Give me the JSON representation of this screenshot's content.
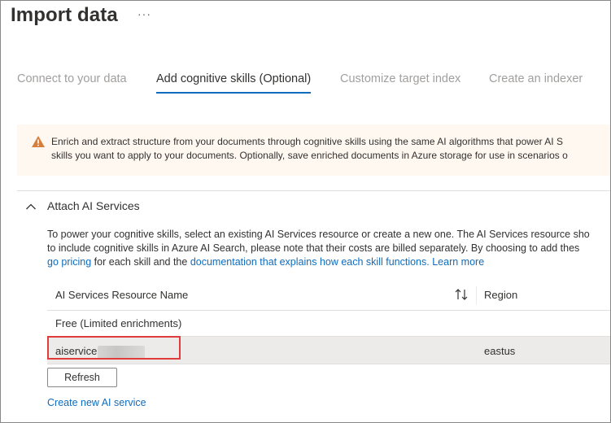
{
  "page": {
    "title": "Import data",
    "more_glyph": "···"
  },
  "tabs": [
    {
      "label": "Connect to your data",
      "active": false
    },
    {
      "label": "Add cognitive skills (Optional)",
      "active": true
    },
    {
      "label": "Customize target index",
      "active": false
    },
    {
      "label": "Create an indexer",
      "active": false
    }
  ],
  "warning": {
    "line1": "Enrich and extract structure from your documents through cognitive skills using the same AI algorithms that power AI S",
    "line2": "skills you want to apply to your documents. Optionally, save enriched documents in Azure storage for use in scenarios o",
    "icon": "warning-icon",
    "color": "#d67f3c"
  },
  "section": {
    "title": "Attach AI Services",
    "expanded": true,
    "description": {
      "line1": "To power your cognitive skills, select an existing AI Services resource or create a new one. The AI Services resource sho",
      "line2": "to include cognitive skills in Azure AI Search, please note that their costs are billed separately. By choosing to add thes",
      "line3_link1": "go pricing",
      "line3_text1": " for each skill and the ",
      "line3_link2": "documentation that explains how each skill functions.",
      "line3_text2": " ",
      "line3_link3": "Learn more"
    }
  },
  "grid": {
    "columns": {
      "name": "AI Services Resource Name",
      "region": "Region"
    },
    "rows": [
      {
        "name": "Free (Limited enrichments)",
        "region": ""
      },
      {
        "name": "aiservice",
        "region": "eastus",
        "selected": true
      }
    ]
  },
  "actions": {
    "refresh_label": "Refresh",
    "create_link": "Create new AI service"
  },
  "colors": {
    "accent": "#0f6cbd",
    "warning_bg": "#fff8f0",
    "highlight_border": "#e03c3c"
  }
}
